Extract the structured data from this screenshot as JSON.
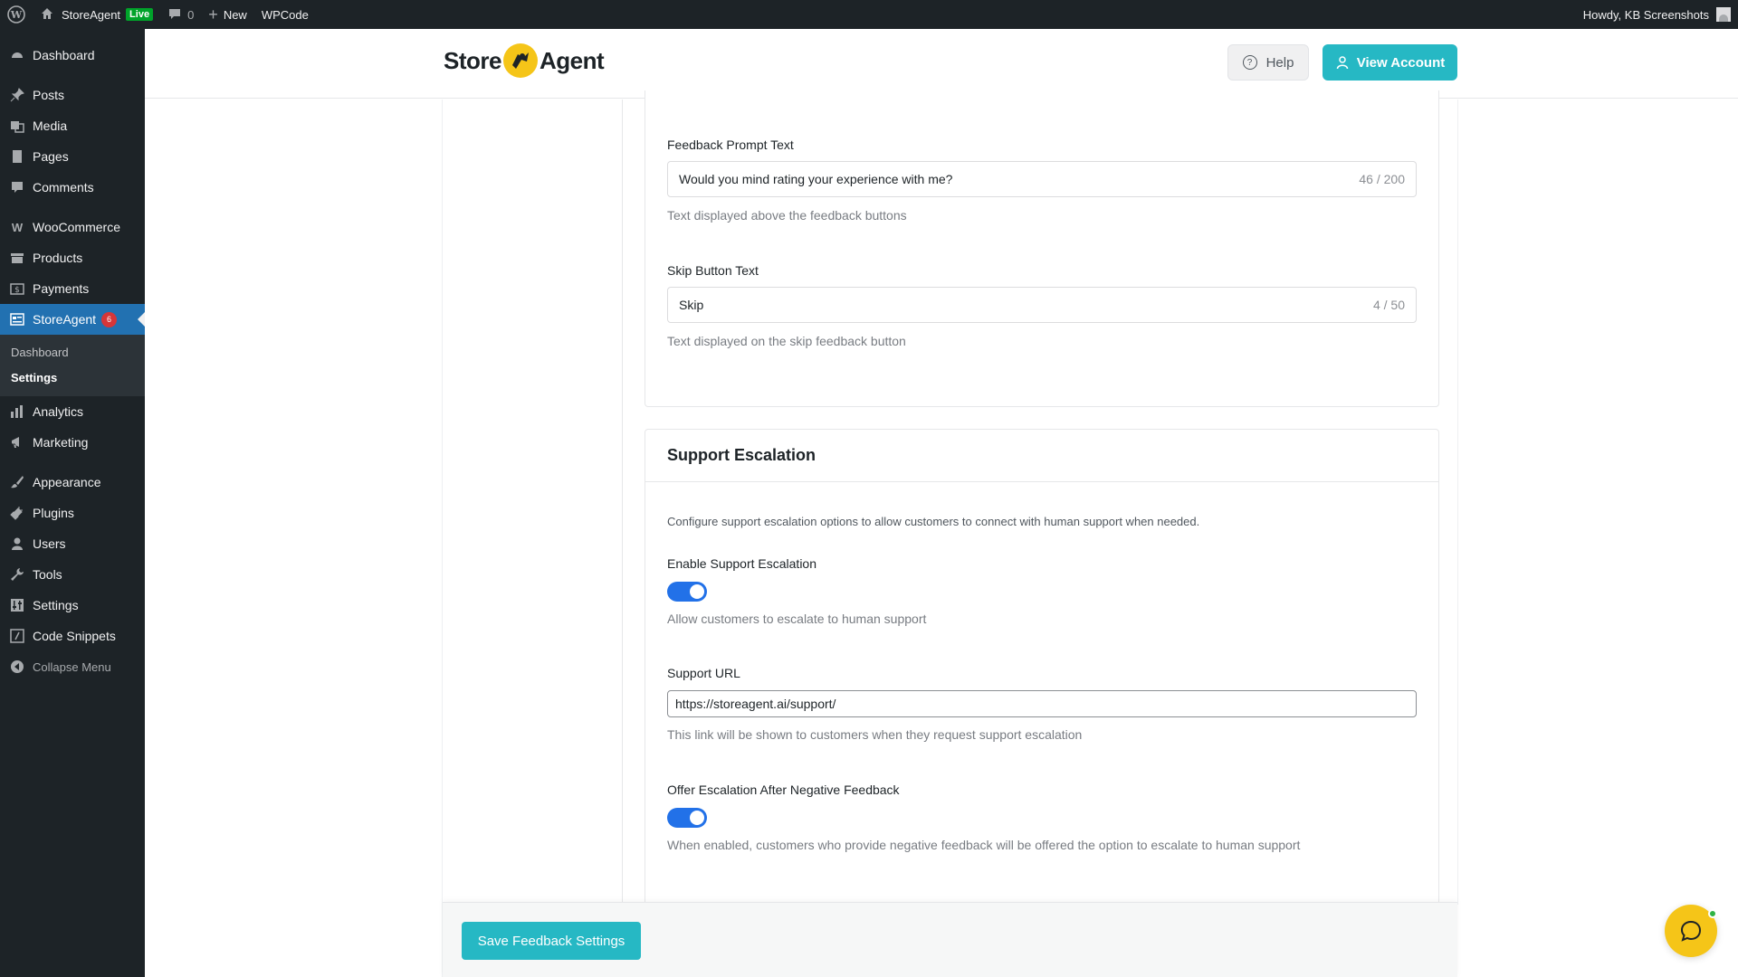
{
  "admin_bar": {
    "site_name": "StoreAgent",
    "live_badge": "Live",
    "comments_count": "0",
    "new_label": "New",
    "wpcode_label": "WPCode",
    "howdy": "Howdy, KB Screenshots"
  },
  "sidebar": {
    "dashboard": "Dashboard",
    "posts": "Posts",
    "media": "Media",
    "pages": "Pages",
    "comments": "Comments",
    "woocommerce": "WooCommerce",
    "products": "Products",
    "payments": "Payments",
    "storeagent": "StoreAgent",
    "storeagent_badge": "6",
    "sub_dashboard": "Dashboard",
    "sub_settings": "Settings",
    "analytics": "Analytics",
    "marketing": "Marketing",
    "appearance": "Appearance",
    "plugins": "Plugins",
    "users": "Users",
    "tools": "Tools",
    "settings": "Settings",
    "code_snippets": "Code Snippets",
    "collapse": "Collapse Menu"
  },
  "header": {
    "logo_left": "Store",
    "logo_right": "Agent",
    "help_label": "Help",
    "view_account_label": "View Account"
  },
  "feedback": {
    "prompt_label": "Feedback Prompt Text",
    "prompt_value": "Would you mind rating your experience with me?",
    "prompt_counter": "46 / 200",
    "prompt_help": "Text displayed above the feedback buttons",
    "skip_label": "Skip Button Text",
    "skip_value": "Skip",
    "skip_counter": "4 / 50",
    "skip_help": "Text displayed on the skip feedback button"
  },
  "escalation": {
    "title": "Support Escalation",
    "description": "Configure support escalation options to allow customers to connect with human support when needed.",
    "enable_label": "Enable Support Escalation",
    "enable_on": true,
    "enable_help": "Allow customers to escalate to human support",
    "url_label": "Support URL",
    "url_value": "https://storeagent.ai/support/",
    "url_help": "This link will be shown to customers when they request support escalation",
    "offer_label": "Offer Escalation After Negative Feedback",
    "offer_on": true,
    "offer_help": "When enabled, customers who provide negative feedback will be offered the option to escalate to human support"
  },
  "footer": {
    "save_label": "Save Feedback Settings"
  },
  "colors": {
    "accent": "#26b8c4",
    "toggle": "#2271e8",
    "wp_blue": "#2271b1",
    "brand_yellow": "#f5c518"
  }
}
